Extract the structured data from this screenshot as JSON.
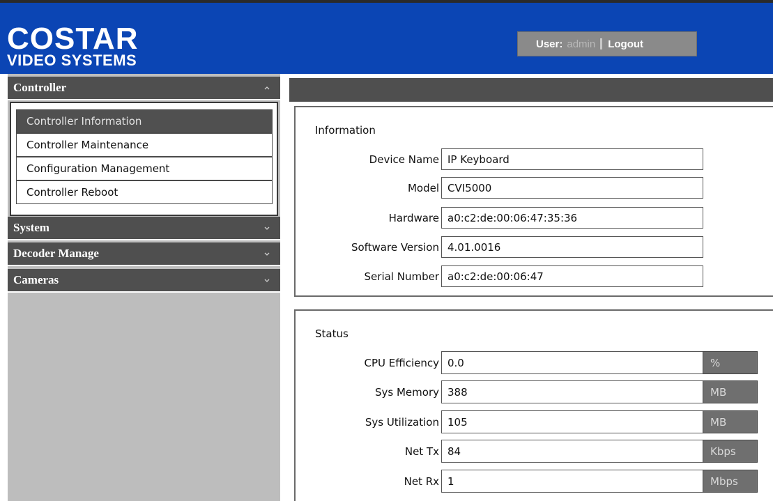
{
  "header": {
    "logo_main": "COSTAR",
    "logo_sub": "VIDEO SYSTEMS",
    "user_label": "User:",
    "user_name": "admin",
    "logout_label": "Logout"
  },
  "sidebar": {
    "sections": [
      {
        "label": "Controller",
        "expanded": true
      },
      {
        "label": "System",
        "expanded": false
      },
      {
        "label": "Decoder Manage",
        "expanded": false
      },
      {
        "label": "Cameras",
        "expanded": false
      }
    ],
    "controller_items": [
      {
        "label": "Controller Information",
        "active": true
      },
      {
        "label": "Controller Maintenance",
        "active": false
      },
      {
        "label": "Configuration Management",
        "active": false
      },
      {
        "label": "Controller Reboot",
        "active": false
      }
    ]
  },
  "information": {
    "title": "Information",
    "fields": [
      {
        "label": "Device Name",
        "value": "IP Keyboard"
      },
      {
        "label": "Model",
        "value": "CVI5000"
      },
      {
        "label": "Hardware",
        "value": "a0:c2:de:00:06:47:35:36"
      },
      {
        "label": "Software Version",
        "value": "4.01.0016"
      },
      {
        "label": "Serial Number",
        "value": "a0:c2:de:00:06:47"
      }
    ]
  },
  "status": {
    "title": "Status",
    "fields": [
      {
        "label": "CPU Efficiency",
        "value": "0.0",
        "unit": "%"
      },
      {
        "label": "Sys Memory",
        "value": "388",
        "unit": "MB"
      },
      {
        "label": "Sys Utilization",
        "value": "105",
        "unit": "MB"
      },
      {
        "label": "Net Tx",
        "value": "84",
        "unit": "Kbps"
      },
      {
        "label": "Net Rx",
        "value": "1",
        "unit": "Mbps"
      }
    ]
  },
  "colors": {
    "header_bg": "#0b45b4",
    "section_bg": "#4f4f4f",
    "sidebar_bg": "#bdbdbd",
    "unit_bg": "#6f6f6f"
  }
}
